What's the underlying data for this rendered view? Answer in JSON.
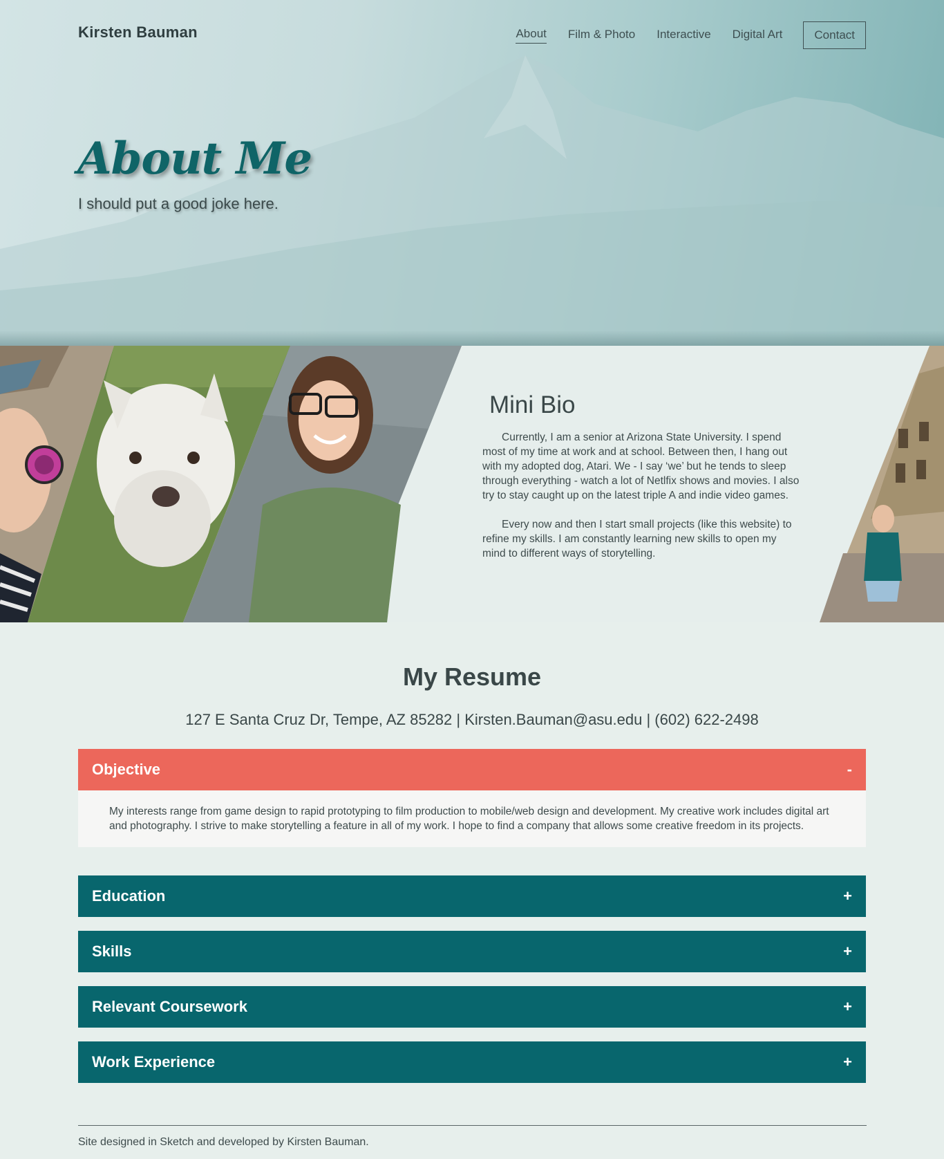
{
  "header": {
    "site_name": "Kirsten Bauman",
    "nav": [
      "About",
      "Film & Photo",
      "Interactive",
      "Digital Art"
    ],
    "active_nav": "About",
    "contact_label": "Contact"
  },
  "hero": {
    "title": "About Me",
    "subtitle": "I should put a good joke here."
  },
  "bio": {
    "title": "Mini Bio",
    "paragraphs": [
      "Currently, I am a senior at Arizona State University. I spend most of my time at work and at school. Between then, I hang out with my adopted dog, Atari. We - I say ‘we’ but he tends to sleep through everything - watch a lot of Netlfix shows and movies. I also try to stay caught up on the latest triple A and indie video games.",
      "Every now and then I start small projects (like this website) to refine my skills. I am constantly learning new skills to open my mind to different ways of storytelling."
    ]
  },
  "resume": {
    "title": "My Resume",
    "contact_line": "127 E Santa Cruz Dr, Tempe, AZ 85282 | Kirsten.Bauman@asu.edu | (602) 622-2498",
    "sections": [
      {
        "label": "Objective",
        "toggle": "-",
        "expanded": true,
        "body": "My interests range from game design to rapid prototyping to film production to mobile/web design and development. My creative work includes digital art and photography. I strive to make storytelling a feature in all of my work. I hope to find a company that allows some creative freedom in its projects."
      },
      {
        "label": "Education",
        "toggle": "+",
        "expanded": false
      },
      {
        "label": "Skills",
        "toggle": "+",
        "expanded": false
      },
      {
        "label": "Relevant Coursework",
        "toggle": "+",
        "expanded": false
      },
      {
        "label": "Work Experience",
        "toggle": "+",
        "expanded": false
      }
    ]
  },
  "footer": {
    "text": "Site designed in Sketch and developed by Kirsten Bauman."
  },
  "colors": {
    "teal": "#08666d",
    "coral": "#ec675b",
    "title_teal": "#0f6467",
    "page_bg": "#e7efec"
  }
}
